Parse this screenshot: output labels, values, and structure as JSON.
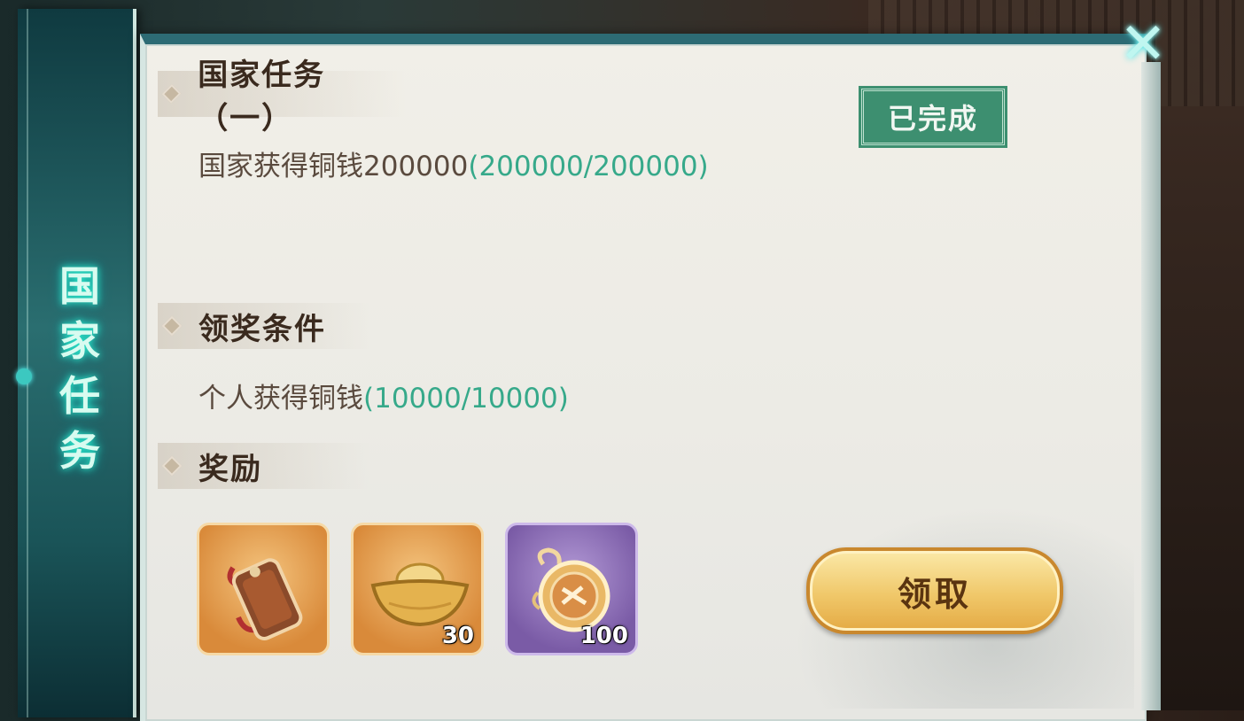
{
  "window": {
    "banner_title": "国家任务",
    "close_symbol": "✕"
  },
  "task": {
    "title": "国家任务（一）",
    "description": "国家获得铜钱200000",
    "progress": "(200000/200000)",
    "status_stamp": "已完成"
  },
  "claim_condition": {
    "header": "领奖条件",
    "description": "个人获得铜钱",
    "progress": "(10000/10000)"
  },
  "rewards": {
    "header": "奖励",
    "items": [
      {
        "icon": "general-token-icon",
        "quantity": ""
      },
      {
        "icon": "gold-ingot-icon",
        "quantity": "30"
      },
      {
        "icon": "medallion-icon",
        "quantity": "100"
      }
    ]
  },
  "claim_button": {
    "label": "领取"
  },
  "colors": {
    "accent_teal": "#2d6b74",
    "progress_green": "#36a98a",
    "stamp_green": "#3d8f70",
    "button_gold": "#f0c86a"
  }
}
